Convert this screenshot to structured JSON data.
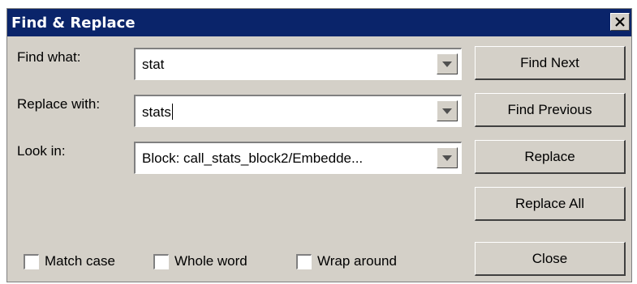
{
  "window": {
    "title": "Find & Replace"
  },
  "fields": {
    "find": {
      "label": "Find what:",
      "value": "stat"
    },
    "replace": {
      "label": "Replace with:",
      "value": "stats"
    },
    "look_in": {
      "label": "Look in:",
      "value": "Block: call_stats_block2/Embedde..."
    }
  },
  "buttons": {
    "find_next": "Find Next",
    "find_previous": "Find Previous",
    "replace": "Replace",
    "replace_all": "Replace All",
    "close": "Close"
  },
  "options": {
    "match_case": {
      "label": "Match case",
      "checked": false
    },
    "whole_word": {
      "label": "Whole word",
      "checked": false
    },
    "wrap_around": {
      "label": "Wrap around",
      "checked": false
    }
  },
  "icons": {
    "close": "close-icon",
    "dropdown": "chevron-down-icon"
  },
  "colors": {
    "titlebar": "#0a246a",
    "dialog_bg": "#d4d0c8"
  }
}
